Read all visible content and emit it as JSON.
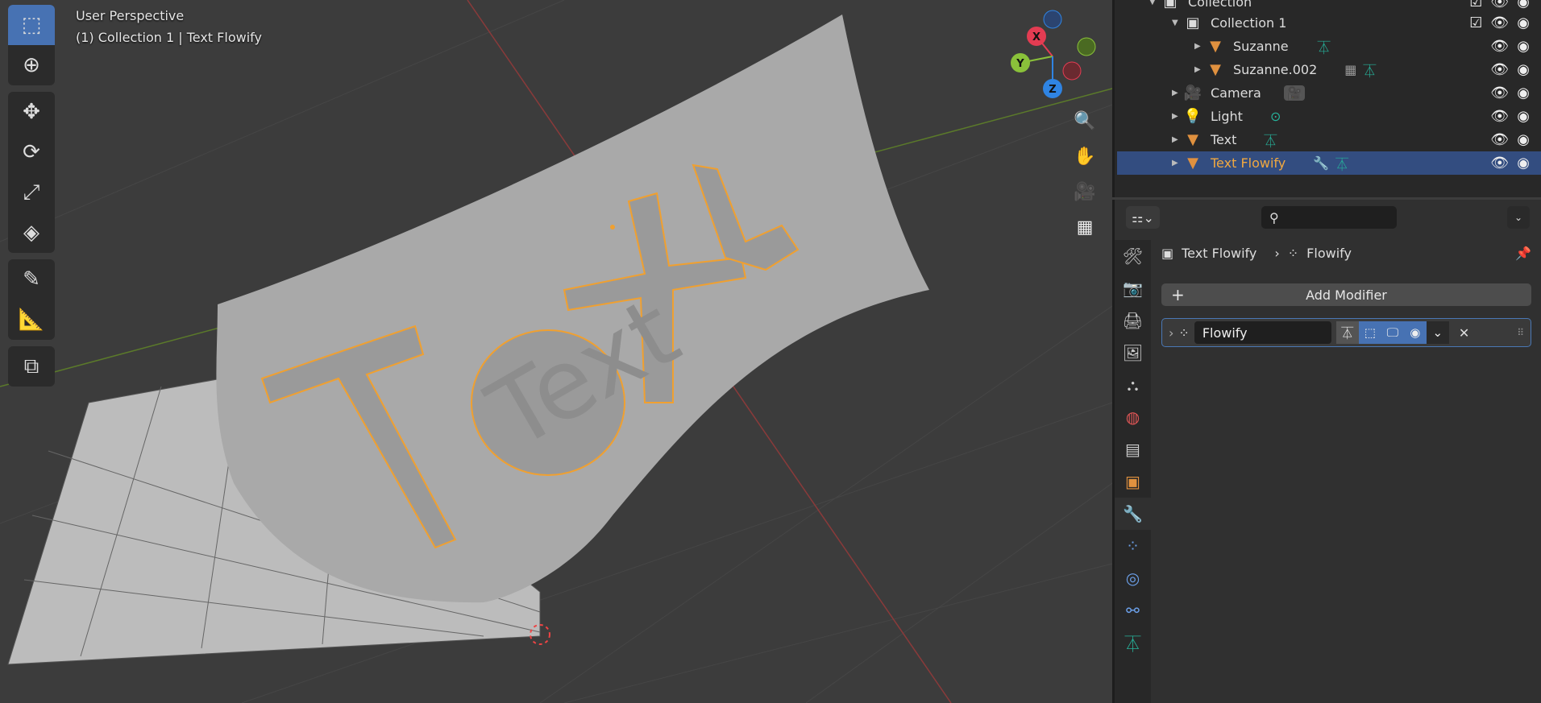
{
  "viewport": {
    "perspective": "User Perspective",
    "context": "(1) Collection 1 | Text Flowify",
    "gizmo_axes": [
      "X",
      "Y",
      "Z"
    ],
    "scene_text": "Text"
  },
  "toolbar": {
    "tools": [
      "select-box",
      "cursor",
      "move",
      "rotate",
      "scale",
      "transform",
      "annotate",
      "measure",
      "add-cube"
    ],
    "active": "select-box"
  },
  "outliner": {
    "rows": [
      {
        "label": "Collection",
        "depth": 0,
        "type": "collection"
      },
      {
        "label": "Collection 1",
        "depth": 1,
        "type": "collection"
      },
      {
        "label": "Suzanne",
        "depth": 2,
        "type": "mesh"
      },
      {
        "label": "Suzanne.002",
        "depth": 2,
        "type": "mesh"
      },
      {
        "label": "Camera",
        "depth": 1,
        "type": "camera"
      },
      {
        "label": "Light",
        "depth": 1,
        "type": "light"
      },
      {
        "label": "Text",
        "depth": 1,
        "type": "mesh"
      },
      {
        "label": "Text Flowify",
        "depth": 1,
        "type": "mesh",
        "selected": true
      }
    ]
  },
  "properties": {
    "search_placeholder": "",
    "breadcrumb": {
      "object": "Text Flowify",
      "modifier": "Flowify"
    },
    "add_modifier_label": "Add Modifier",
    "modifier": {
      "name": "Flowify",
      "edit_mode": true,
      "viewport": true,
      "render": true
    }
  },
  "colors": {
    "accent": "#4772b3",
    "selected_row": "#334d80",
    "object_orange": "#e0913f",
    "data_teal": "#26b39b"
  }
}
